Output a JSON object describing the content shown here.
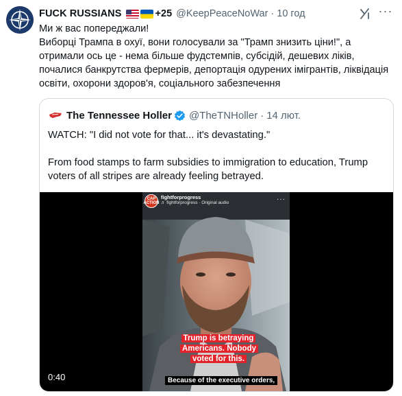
{
  "tweet": {
    "author_name": "FUCK RUSSIANS",
    "flags": [
      "flag-us",
      "flag-ua"
    ],
    "plus_count": "+25",
    "handle": "@KeepPeaceNoWar",
    "separator": "·",
    "time": "10 год",
    "text": "Ми ж вас попереджали!\nВиборці Трампа в охуї, вони голосували за \"Трамп знизить ціни!\", а отримали ось це - нема більше фудстемпів, субсідій, дешевих ліків, почалися банкрутства фермерів, депортація одурених імігрантів, ліквідація освіти, охорони здоров'я, соціального забезпечення",
    "more_label": "···",
    "icons": [
      "nato-star-avatar",
      "grok-icon",
      "more-icon"
    ]
  },
  "quote": {
    "author_name": "The Tennessee Holler",
    "verified_color": "#1d9bf0",
    "handle": "@TheTNHoller",
    "separator": "·",
    "time": "14 лют.",
    "paragraph_1": "WATCH: \"I did not vote for that... it's devastating.\"",
    "paragraph_2": "From food stamps to farm subsidies to immigration to education, Trump voters of all stripes are already feeling betrayed.",
    "video": {
      "ig_logo_text": "CAP ACTION",
      "ig_username": "fightforprogress",
      "ig_audio": "♬ fightforprogress · Original audio",
      "ig_more": "···",
      "red_caption": "Trump is betraying Americans. Nobody voted for this.",
      "subtitle": "Because of the executive orders,",
      "timecode": "0:40"
    }
  },
  "colors": {
    "text": "#0f1419",
    "secondary": "#536471",
    "border": "#cfd9de",
    "caption_red": "#e3232b"
  }
}
